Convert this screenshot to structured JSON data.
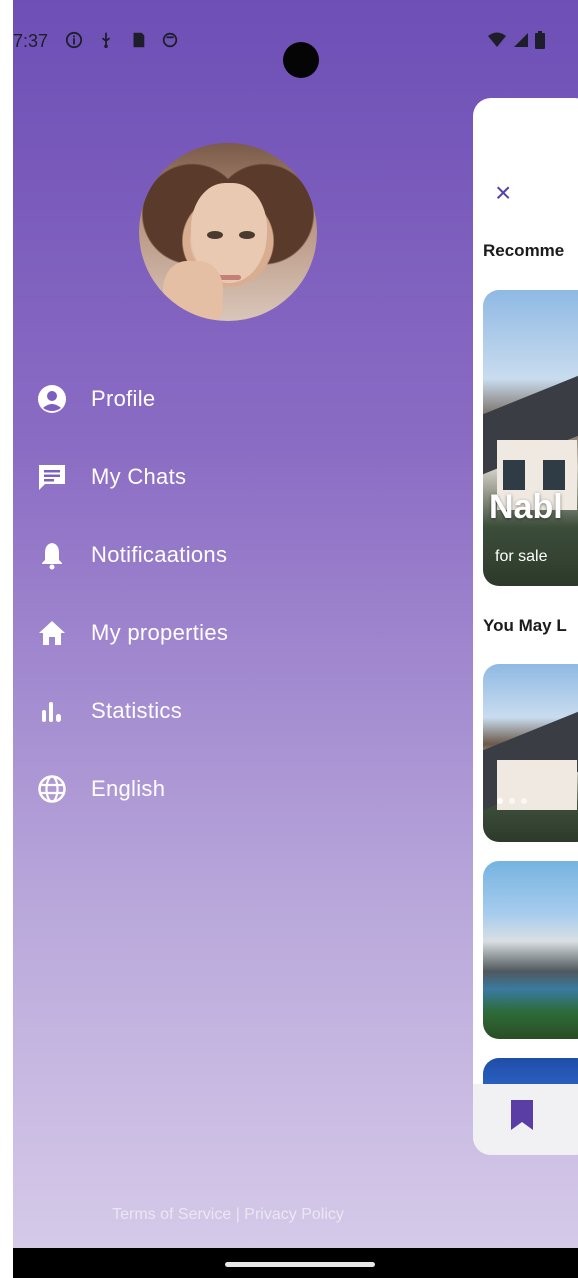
{
  "status_bar": {
    "time": "7:37",
    "left_icons": [
      "info-icon",
      "usb-icon",
      "sd-card-icon",
      "sync-icon"
    ],
    "right_icons": [
      "wifi-icon",
      "signal-icon",
      "battery-icon"
    ]
  },
  "drawer": {
    "menu": [
      {
        "label": "Profile",
        "icon": "account-circle-icon"
      },
      {
        "label": "My Chats",
        "icon": "chat-icon"
      },
      {
        "label": "Notificaations",
        "icon": "bell-icon"
      },
      {
        "label": "My properties",
        "icon": "home-icon"
      },
      {
        "label": "Statistics",
        "icon": "bar-chart-icon"
      },
      {
        "label": "English",
        "icon": "globe-icon"
      }
    ],
    "footer": "Terms of Service | Privacy Policy"
  },
  "main": {
    "close_icon": "×",
    "recommended_title": "Recomme",
    "featured_title": "Nabl",
    "featured_subtitle": "for sale",
    "may_like_title": "You May L",
    "bottom_nav_icon": "bookmark-icon"
  },
  "colors": {
    "accent": "#5a3ea6",
    "gradient_top": "#6d4fb6",
    "gradient_bottom": "#d8cdea"
  }
}
